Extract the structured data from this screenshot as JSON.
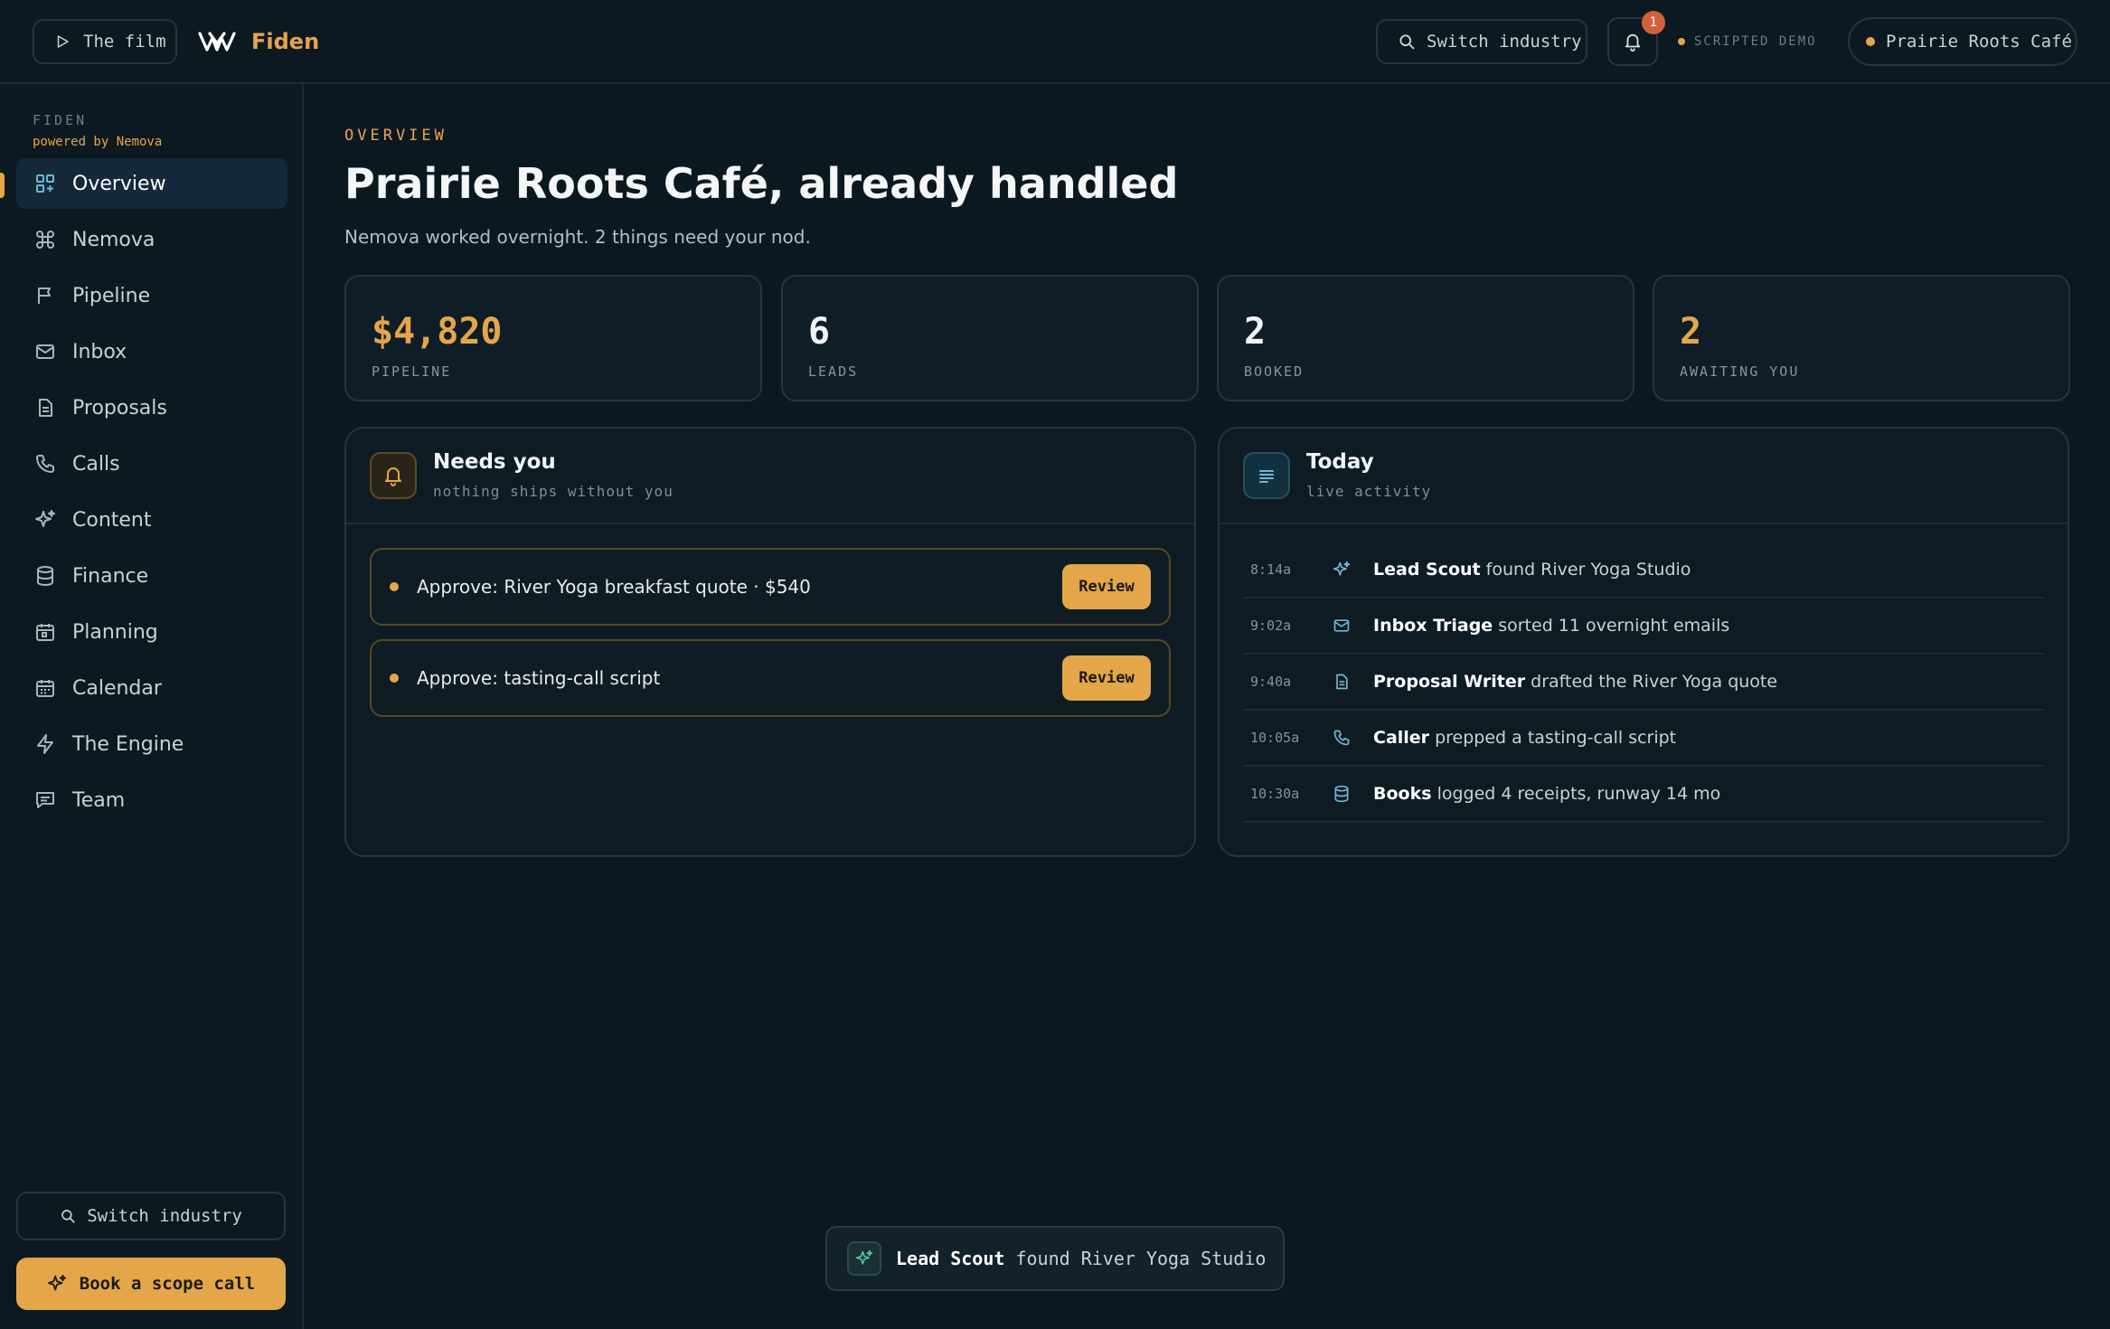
{
  "topbar": {
    "film_label": "The film",
    "brand_name": "Fiden",
    "switch_label": "Switch industry",
    "notification_count": "1",
    "scripted_label": "SCRIPTED DEMO",
    "business_name": "Prairie Roots Café"
  },
  "sidebar": {
    "app_label": "FIDEN",
    "powered_by": "powered by Nemova",
    "items": [
      {
        "label": "Overview",
        "icon": "grid-plus-icon",
        "active": true
      },
      {
        "label": "Nemova",
        "icon": "command-icon"
      },
      {
        "label": "Pipeline",
        "icon": "flag-icon"
      },
      {
        "label": "Inbox",
        "icon": "mail-icon"
      },
      {
        "label": "Proposals",
        "icon": "document-icon"
      },
      {
        "label": "Calls",
        "icon": "phone-icon"
      },
      {
        "label": "Content",
        "icon": "sparkle-icon"
      },
      {
        "label": "Finance",
        "icon": "database-icon"
      },
      {
        "label": "Planning",
        "icon": "calendar-plan-icon"
      },
      {
        "label": "Calendar",
        "icon": "calendar-icon"
      },
      {
        "label": "The Engine",
        "icon": "bolt-icon"
      },
      {
        "label": "Team",
        "icon": "chat-icon"
      }
    ],
    "switch_label": "Switch industry",
    "scope_label": "Book a scope call"
  },
  "overview": {
    "eyebrow": "OVERVIEW",
    "title": "Prairie Roots Café, already handled",
    "subtitle": "Nemova worked overnight. 2 things need your nod."
  },
  "stats": [
    {
      "value": "$4,820",
      "label": "PIPELINE",
      "accent": true
    },
    {
      "value": "6",
      "label": "LEADS",
      "accent": false
    },
    {
      "value": "2",
      "label": "BOOKED",
      "accent": false
    },
    {
      "value": "2",
      "label": "AWAITING YOU",
      "accent": true
    }
  ],
  "needs_you": {
    "title": "Needs you",
    "subtitle": "nothing ships without you",
    "items": [
      {
        "text": "Approve: River Yoga breakfast quote · $540",
        "action": "Review"
      },
      {
        "text": "Approve: tasting-call script",
        "action": "Review"
      }
    ]
  },
  "today": {
    "title": "Today",
    "subtitle": "live activity",
    "activity": [
      {
        "time": "8:14a",
        "icon": "sparkle-icon",
        "agent": "Lead Scout",
        "text": " found River Yoga Studio"
      },
      {
        "time": "9:02a",
        "icon": "mail-icon",
        "agent": "Inbox Triage",
        "text": " sorted 11 overnight emails"
      },
      {
        "time": "9:40a",
        "icon": "document-icon",
        "agent": "Proposal Writer",
        "text": " drafted the River Yoga quote"
      },
      {
        "time": "10:05a",
        "icon": "phone-icon",
        "agent": "Caller",
        "text": " prepped a tasting-call script"
      },
      {
        "time": "10:30a",
        "icon": "database-icon",
        "agent": "Books",
        "text": " logged 4 receipts, runway 14 mo"
      }
    ]
  },
  "toast": {
    "agent": "Lead Scout",
    "text": " found River Yoga Studio"
  },
  "colors": {
    "accent": "#e6a54a",
    "background": "#0c1820",
    "badge": "#d0613a",
    "activity_icon": "#6fb6d8",
    "toast_icon": "#4fc3a1"
  }
}
